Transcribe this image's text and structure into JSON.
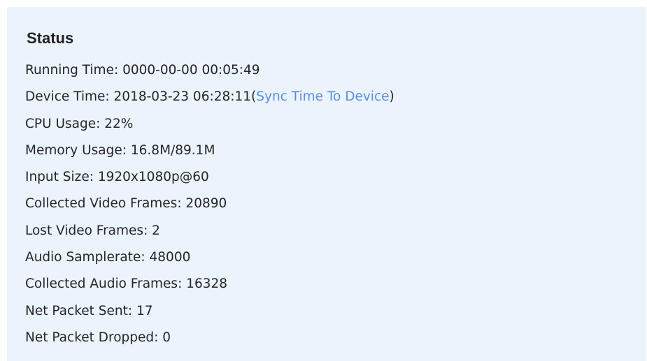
{
  "status": {
    "title": "Status",
    "running_time": "Running Time: 0000-00-00 00:05:49",
    "device_time": "Device Time: 2018-03-23 06:28:11",
    "device_time_link_open": "(",
    "sync_link_label": "Sync Time To Device",
    "device_time_link_close": ")",
    "cpu_usage": "CPU Usage: 22%",
    "memory_usage": "Memory Usage: 16.8M/89.1M",
    "input_size": "Input Size: 1920x1080p@60",
    "collected_video_frames": "Collected Video Frames: 20890",
    "lost_video_frames": "Lost Video Frames: 2",
    "audio_samplerate": "Audio Samplerate: 48000",
    "collected_audio_frames": "Collected Audio Frames: 16328",
    "net_packet_sent": "Net Packet Sent: 17",
    "net_packet_dropped": "Net Packet Dropped: 0"
  },
  "colors": {
    "panel_background": "#ebf3fc",
    "link": "#5a8fe0",
    "text": "#262626"
  }
}
